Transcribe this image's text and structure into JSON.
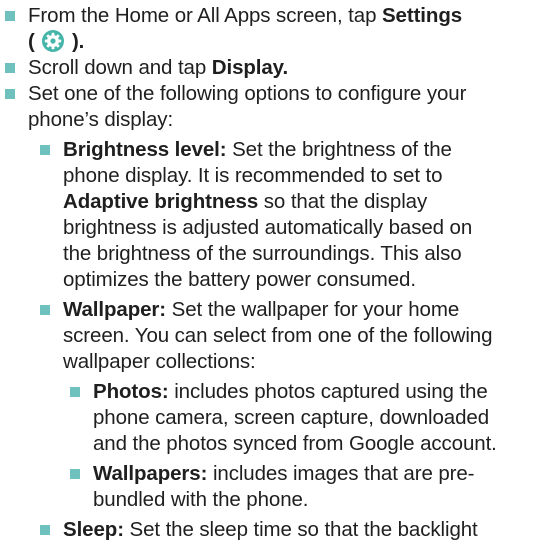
{
  "colors": {
    "bullet": "#6fc1be",
    "text": "#1f1f1f",
    "settings_icon_bg": "#45b5aa"
  },
  "steps": [
    {
      "line1_pre": "From the Home or All Apps screen, tap ",
      "line1_bold": "Settings",
      "line2_open": "(",
      "icon": "settings-gear-icon",
      "line2_close": ")."
    },
    {
      "pre": "Scroll down and tap ",
      "bold": "Display."
    },
    {
      "line1": "Set one of the following options to configure your",
      "line2": "phone’s display:"
    }
  ],
  "options": {
    "brightness": {
      "term": "Brightness level:",
      "line1": " Set the brightness of the",
      "line2": "phone display. It is recommended to set to",
      "line3_bold": "Adaptive brightness",
      "line3": " so that the display",
      "line4": "brightness is adjusted automatically based on",
      "line5": "the brightness of the surroundings. This also",
      "line6": "optimizes the battery power consumed."
    },
    "wallpaper": {
      "term": "Wallpaper:",
      "line1": " Set the wallpaper for your home",
      "line2": "screen. You can select from one of the following",
      "line3": "wallpaper collections:"
    },
    "photos": {
      "term": "Photos:",
      "line1": " includes photos captured using the",
      "line2": "phone camera, screen capture, downloaded",
      "line3": "and the photos synced from Google account."
    },
    "wallpapers": {
      "term": "Wallpapers:",
      "line1": " includes images that are pre-",
      "line2": "bundled with the phone."
    },
    "sleep": {
      "term": "Sleep:",
      "line1": " Set the sleep time so that the backlight"
    }
  }
}
